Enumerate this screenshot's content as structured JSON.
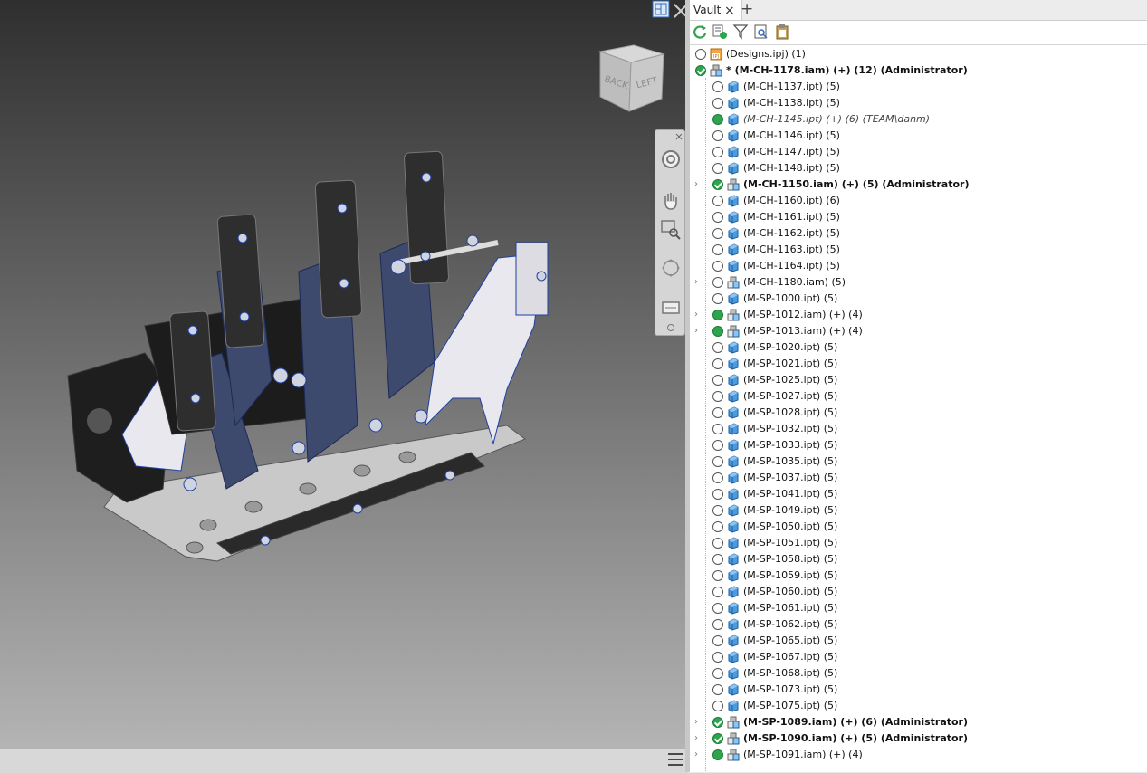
{
  "viewport": {
    "cube_faces": [
      "BACK",
      "LEFT"
    ]
  },
  "vault": {
    "tab_label": "Vault",
    "tab_close": "×",
    "tab_add": "+",
    "toolbar": [
      "refresh-icon",
      "check-status-icon",
      "filter-icon",
      "find-icon",
      "clipboard-icon"
    ],
    "rows": [
      {
        "label": "(Designs.ipj) (1)",
        "status": "empty",
        "icon": "project",
        "level": 0,
        "bold": false,
        "strike": false,
        "expand": false
      },
      {
        "label": "* (M-CH-1178.iam) (+) (12) (Administrator)",
        "status": "check",
        "icon": "assembly",
        "level": 0,
        "bold": true,
        "strike": false,
        "expand": false
      },
      {
        "label": "(M-CH-1137.ipt) (5)",
        "status": "empty",
        "icon": "part",
        "level": 1,
        "bold": false,
        "strike": false,
        "expand": false
      },
      {
        "label": "(M-CH-1138.ipt) (5)",
        "status": "empty",
        "icon": "part",
        "level": 1,
        "bold": false,
        "strike": false,
        "expand": false
      },
      {
        "label": "(M-CH-1145.ipt) (+) (6) (TEAM\\danm)",
        "status": "green",
        "icon": "part",
        "level": 1,
        "bold": false,
        "strike": true,
        "expand": false
      },
      {
        "label": "(M-CH-1146.ipt) (5)",
        "status": "empty",
        "icon": "part",
        "level": 1,
        "bold": false,
        "strike": false,
        "expand": false
      },
      {
        "label": "(M-CH-1147.ipt) (5)",
        "status": "empty",
        "icon": "part",
        "level": 1,
        "bold": false,
        "strike": false,
        "expand": false
      },
      {
        "label": "(M-CH-1148.ipt) (5)",
        "status": "empty",
        "icon": "part",
        "level": 1,
        "bold": false,
        "strike": false,
        "expand": false
      },
      {
        "label": "(M-CH-1150.iam) (+) (5) (Administrator)",
        "status": "check",
        "icon": "assembly",
        "level": 1,
        "bold": true,
        "strike": false,
        "expand": true
      },
      {
        "label": "(M-CH-1160.ipt) (6)",
        "status": "empty",
        "icon": "part",
        "level": 1,
        "bold": false,
        "strike": false,
        "expand": false
      },
      {
        "label": "(M-CH-1161.ipt) (5)",
        "status": "empty",
        "icon": "part",
        "level": 1,
        "bold": false,
        "strike": false,
        "expand": false
      },
      {
        "label": "(M-CH-1162.ipt) (5)",
        "status": "empty",
        "icon": "part",
        "level": 1,
        "bold": false,
        "strike": false,
        "expand": false
      },
      {
        "label": "(M-CH-1163.ipt) (5)",
        "status": "empty",
        "icon": "part",
        "level": 1,
        "bold": false,
        "strike": false,
        "expand": false
      },
      {
        "label": "(M-CH-1164.ipt) (5)",
        "status": "empty",
        "icon": "part",
        "level": 1,
        "bold": false,
        "strike": false,
        "expand": false
      },
      {
        "label": "(M-CH-1180.iam) (5)",
        "status": "empty",
        "icon": "assembly",
        "level": 1,
        "bold": false,
        "strike": false,
        "expand": true
      },
      {
        "label": "(M-SP-1000.ipt) (5)",
        "status": "empty",
        "icon": "part",
        "level": 1,
        "bold": false,
        "strike": false,
        "expand": false
      },
      {
        "label": "(M-SP-1012.iam) (+) (4)",
        "status": "green",
        "icon": "assembly",
        "level": 1,
        "bold": false,
        "strike": false,
        "expand": true
      },
      {
        "label": "(M-SP-1013.iam) (+) (4)",
        "status": "green",
        "icon": "assembly",
        "level": 1,
        "bold": false,
        "strike": false,
        "expand": true
      },
      {
        "label": "(M-SP-1020.ipt) (5)",
        "status": "empty",
        "icon": "part",
        "level": 1,
        "bold": false,
        "strike": false,
        "expand": false
      },
      {
        "label": "(M-SP-1021.ipt) (5)",
        "status": "empty",
        "icon": "part",
        "level": 1,
        "bold": false,
        "strike": false,
        "expand": false
      },
      {
        "label": "(M-SP-1025.ipt) (5)",
        "status": "empty",
        "icon": "part",
        "level": 1,
        "bold": false,
        "strike": false,
        "expand": false
      },
      {
        "label": "(M-SP-1027.ipt) (5)",
        "status": "empty",
        "icon": "part",
        "level": 1,
        "bold": false,
        "strike": false,
        "expand": false
      },
      {
        "label": "(M-SP-1028.ipt) (5)",
        "status": "empty",
        "icon": "part",
        "level": 1,
        "bold": false,
        "strike": false,
        "expand": false
      },
      {
        "label": "(M-SP-1032.ipt) (5)",
        "status": "empty",
        "icon": "part",
        "level": 1,
        "bold": false,
        "strike": false,
        "expand": false
      },
      {
        "label": "(M-SP-1033.ipt) (5)",
        "status": "empty",
        "icon": "part",
        "level": 1,
        "bold": false,
        "strike": false,
        "expand": false
      },
      {
        "label": "(M-SP-1035.ipt) (5)",
        "status": "empty",
        "icon": "part",
        "level": 1,
        "bold": false,
        "strike": false,
        "expand": false
      },
      {
        "label": "(M-SP-1037.ipt) (5)",
        "status": "empty",
        "icon": "part",
        "level": 1,
        "bold": false,
        "strike": false,
        "expand": false
      },
      {
        "label": "(M-SP-1041.ipt) (5)",
        "status": "empty",
        "icon": "part",
        "level": 1,
        "bold": false,
        "strike": false,
        "expand": false
      },
      {
        "label": "(M-SP-1049.ipt) (5)",
        "status": "empty",
        "icon": "part",
        "level": 1,
        "bold": false,
        "strike": false,
        "expand": false
      },
      {
        "label": "(M-SP-1050.ipt) (5)",
        "status": "empty",
        "icon": "part",
        "level": 1,
        "bold": false,
        "strike": false,
        "expand": false
      },
      {
        "label": "(M-SP-1051.ipt) (5)",
        "status": "empty",
        "icon": "part",
        "level": 1,
        "bold": false,
        "strike": false,
        "expand": false
      },
      {
        "label": "(M-SP-1058.ipt) (5)",
        "status": "empty",
        "icon": "part",
        "level": 1,
        "bold": false,
        "strike": false,
        "expand": false
      },
      {
        "label": "(M-SP-1059.ipt) (5)",
        "status": "empty",
        "icon": "part",
        "level": 1,
        "bold": false,
        "strike": false,
        "expand": false
      },
      {
        "label": "(M-SP-1060.ipt) (5)",
        "status": "empty",
        "icon": "part",
        "level": 1,
        "bold": false,
        "strike": false,
        "expand": false
      },
      {
        "label": "(M-SP-1061.ipt) (5)",
        "status": "empty",
        "icon": "part",
        "level": 1,
        "bold": false,
        "strike": false,
        "expand": false
      },
      {
        "label": "(M-SP-1062.ipt) (5)",
        "status": "empty",
        "icon": "part",
        "level": 1,
        "bold": false,
        "strike": false,
        "expand": false
      },
      {
        "label": "(M-SP-1065.ipt) (5)",
        "status": "empty",
        "icon": "part",
        "level": 1,
        "bold": false,
        "strike": false,
        "expand": false
      },
      {
        "label": "(M-SP-1067.ipt) (5)",
        "status": "empty",
        "icon": "part",
        "level": 1,
        "bold": false,
        "strike": false,
        "expand": false
      },
      {
        "label": "(M-SP-1068.ipt) (5)",
        "status": "empty",
        "icon": "part",
        "level": 1,
        "bold": false,
        "strike": false,
        "expand": false
      },
      {
        "label": "(M-SP-1073.ipt) (5)",
        "status": "empty",
        "icon": "part",
        "level": 1,
        "bold": false,
        "strike": false,
        "expand": false
      },
      {
        "label": "(M-SP-1075.ipt) (5)",
        "status": "empty",
        "icon": "part",
        "level": 1,
        "bold": false,
        "strike": false,
        "expand": false
      },
      {
        "label": "(M-SP-1089.iam) (+) (6) (Administrator)",
        "status": "check",
        "icon": "assembly",
        "level": 1,
        "bold": true,
        "strike": false,
        "expand": true
      },
      {
        "label": "(M-SP-1090.iam) (+) (5) (Administrator)",
        "status": "check",
        "icon": "assembly",
        "level": 1,
        "bold": true,
        "strike": false,
        "expand": true
      },
      {
        "label": "(M-SP-1091.iam) (+) (4)",
        "status": "green",
        "icon": "assembly",
        "level": 1,
        "bold": false,
        "strike": false,
        "expand": true
      }
    ]
  }
}
